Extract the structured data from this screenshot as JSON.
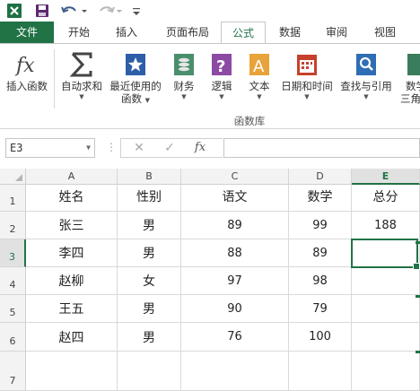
{
  "ribbon": {
    "tabs": {
      "file": "文件",
      "home": "开始",
      "insert": "插入",
      "layout": "页面布局",
      "formula": "公式",
      "data": "数据",
      "review": "审阅",
      "view": "视图"
    },
    "buttons": {
      "insert_function": "插入函数",
      "autosum": "自动求和",
      "recent_line1": "最近使用的",
      "recent_line2": "函数",
      "financial": "财务",
      "logical": "逻辑",
      "text": "文本",
      "datetime": "日期和时间",
      "lookup": "查找与引用",
      "math_line1": "数学",
      "math_line2": "三角"
    },
    "group_label": "函数库"
  },
  "formula_bar": {
    "name_box": "E3",
    "fx_label": "fx",
    "value": ""
  },
  "grid": {
    "columns": [
      "A",
      "B",
      "C",
      "D",
      "E"
    ],
    "rows": [
      "1",
      "2",
      "3",
      "4",
      "5",
      "6",
      "7"
    ],
    "selected_cell": "E3",
    "cells": [
      [
        "姓名",
        "性别",
        "语文",
        "数学",
        "总分"
      ],
      [
        "张三",
        "男",
        "89",
        "99",
        "188"
      ],
      [
        "李四",
        "男",
        "88",
        "89",
        ""
      ],
      [
        "赵柳",
        "女",
        "97",
        "98",
        ""
      ],
      [
        "王五",
        "男",
        "90",
        "79",
        ""
      ],
      [
        "赵四",
        "男",
        "76",
        "100",
        ""
      ],
      [
        "",
        "",
        "",
        "",
        ""
      ]
    ]
  },
  "colors": {
    "accent": "#217346"
  }
}
